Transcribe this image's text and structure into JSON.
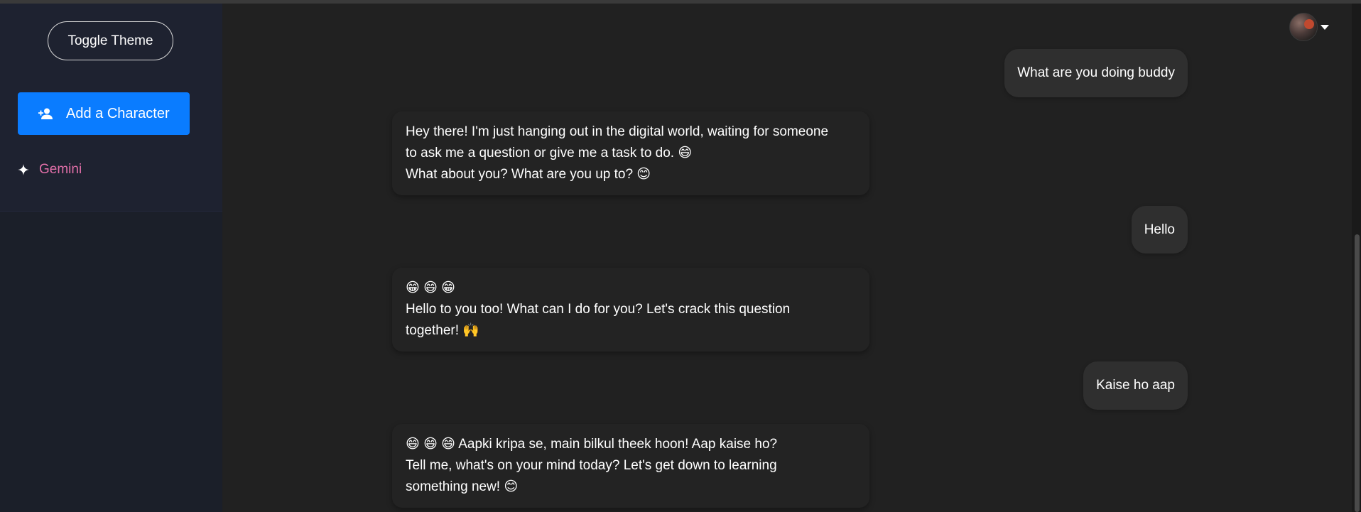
{
  "sidebar": {
    "toggle_theme": "Toggle Theme",
    "add_character": {
      "label": "Add a Character",
      "icon": "person-add-icon"
    },
    "characters": [
      {
        "label": "Gemini",
        "icon": "sparkle-icon",
        "color": "#e16fa8"
      }
    ]
  },
  "header": {
    "avatar_icon": "user-avatar",
    "caret_icon": "chevron-down-icon"
  },
  "chat": {
    "messages": [
      {
        "role": "user",
        "text": "What are you doing buddy"
      },
      {
        "role": "bot",
        "lines": [
          "Hey there! I'm just hanging out in the digital world, waiting for someone",
          "to ask me a question or give me a task to do. 😄",
          "What about you? What are you up to? 😊"
        ]
      },
      {
        "role": "user",
        "text": "Hello"
      },
      {
        "role": "bot",
        "lines": [
          "😁 😄 😁",
          "Hello to you too! What can I do for you? Let's crack this question",
          "together! 🙌"
        ]
      },
      {
        "role": "user",
        "text": "Kaise ho aap"
      },
      {
        "role": "bot",
        "lines": [
          "😄 😄 😄 Aapki kripa se, main bilkul theek hoon! Aap kaise ho?",
          "Tell me, what's on your mind today? Let's get down to learning",
          "something new! 😊"
        ]
      }
    ]
  },
  "colors": {
    "background": "#212121",
    "sidebar": "#1b1f29",
    "accent": "#0a7cff",
    "gemini": "#e16fa8",
    "user_bubble": "#2f2f2f"
  }
}
